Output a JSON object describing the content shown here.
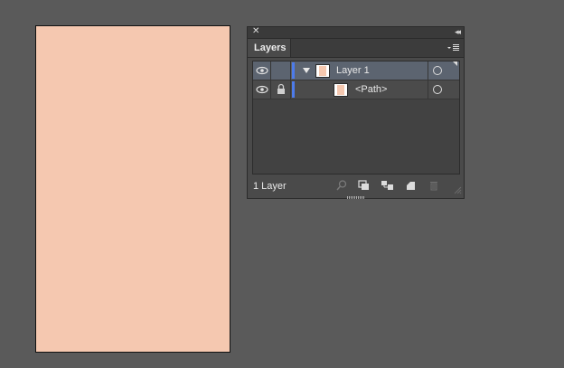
{
  "panel": {
    "tab_label": "Layers",
    "close_glyph": "✕",
    "collapse_glyph": "◂◂",
    "layers": [
      {
        "name": "Layer 1",
        "expanded": true,
        "selected": true,
        "visible": true,
        "locked": false
      },
      {
        "name": "<Path>",
        "selected": false,
        "visible": true,
        "locked": true
      }
    ],
    "footer": {
      "layer_count": "1 Layer",
      "buttons": [
        "locate-object",
        "make-clipping-mask",
        "create-sublayer",
        "create-layer",
        "delete"
      ]
    }
  },
  "colors": {
    "artboard_fill": "#f5c8b0",
    "layer_color": "#4d7bea",
    "selection": "#5c6470"
  }
}
